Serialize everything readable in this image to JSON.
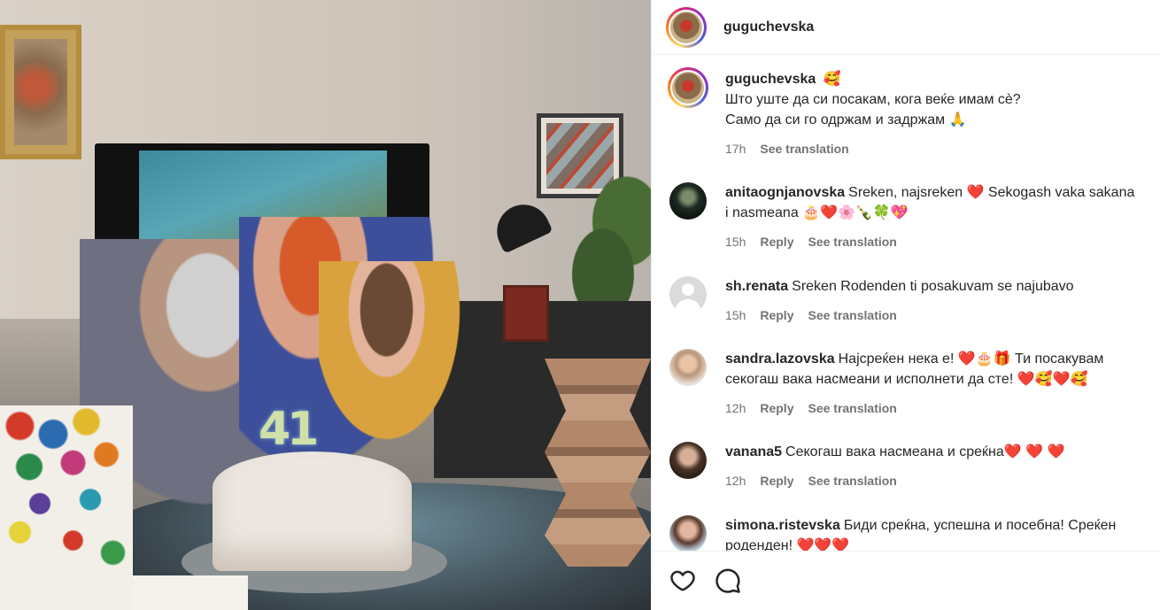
{
  "header": {
    "username": "guguchevska"
  },
  "caption": {
    "username": "guguchevska",
    "emoji": "🥰",
    "line1": "Што уште да си посакам, кога веќе имам сè?",
    "line2": "Само да си го одржам и задржам 🙏",
    "time": "17h",
    "translate": "See translation"
  },
  "comments": [
    {
      "username": "anitaognjanovska",
      "text": "Sreken, najsreken ❤️ Sekogash vaka sakana i nasmeana 🎂❤️🌸🍾🍀💖",
      "time": "15h",
      "reply": "Reply",
      "translate": "See translation"
    },
    {
      "username": "sh.renata",
      "text": "Sreken Rodenden ti posakuvam se najubavo",
      "time": "15h",
      "reply": "Reply",
      "translate": "See translation"
    },
    {
      "username": "sandra.lazovska",
      "text": "Најсреќен нека е! ❤️🎂🎁 Ти посакувам секогаш вака насмеани и исполнети да сте! ❤️🥰❤️🥰",
      "time": "12h",
      "reply": "Reply",
      "translate": "See translation"
    },
    {
      "username": "vanana5",
      "text": "Секогаш вака насмеана и среќна❤️ ❤️ ❤️",
      "time": "12h",
      "reply": "Reply",
      "translate": "See translation"
    },
    {
      "username": "simona.ristevska",
      "text": "Биди среќна, успешна и посебна! Среќен роденден! ❤️❤️❤️",
      "time": "",
      "reply": "",
      "translate": ""
    }
  ],
  "photo": {
    "candles": "41"
  },
  "icons": {
    "like": "heart-icon",
    "comment": "comment-icon"
  }
}
